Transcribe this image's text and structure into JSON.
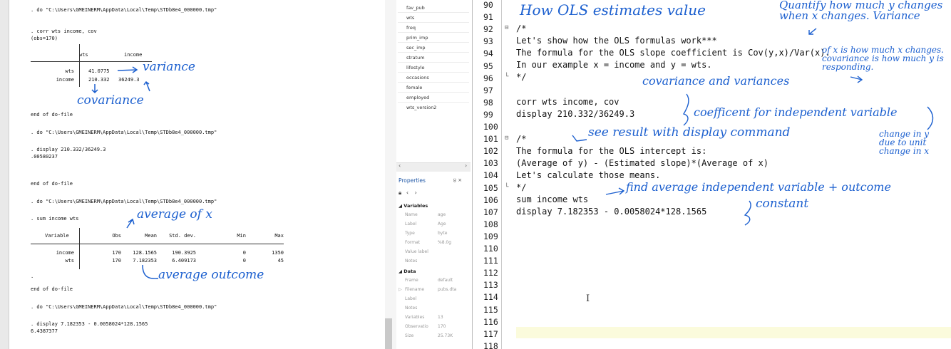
{
  "results": {
    "lines": [
      ". do \"C:\\Users\\GMEINERM\\AppData\\Local\\Temp\\STDb8e4_000000.tmp\"",
      ". corr wts income, cov",
      "(obs=170)",
      "end of do-file",
      ". do \"C:\\Users\\GMEINERM\\AppData\\Local\\Temp\\STDb8e4_000000.tmp\"",
      ". display 210.332/36249.3",
      ".00580237",
      "end of do-file",
      ". do \"C:\\Users\\GMEINERM\\AppData\\Local\\Temp\\STDb8e4_000000.tmp\"",
      ". sum income wts",
      ".",
      "end of do-file",
      ". do \"C:\\Users\\GMEINERM\\AppData\\Local\\Temp\\STDb8e4_000000.tmp\"",
      ". display 7.182353 - 0.0058024*128.1565",
      "6.4387377"
    ],
    "cov_table": {
      "headers": [
        "wts",
        "income"
      ],
      "rows": [
        {
          "label": "wts",
          "values": [
            "41.0775",
            ""
          ]
        },
        {
          "label": "income",
          "values": [
            "210.332",
            "36249.3"
          ]
        }
      ]
    },
    "sum_table": {
      "headers": [
        "Variable",
        "Obs",
        "Mean",
        "Std. dev.",
        "Min",
        "Max"
      ],
      "rows": [
        [
          "income",
          "170",
          "128.1565",
          "190.3925",
          "0",
          "1350"
        ],
        [
          "wts",
          "170",
          "7.182353",
          "6.409173",
          "0",
          "45"
        ]
      ]
    },
    "annotations": [
      "variance",
      "covariance",
      "average of x",
      "average outcome"
    ]
  },
  "variables": {
    "items": [
      "fav_pub",
      "wts",
      "freq",
      "prim_imp",
      "sec_imp",
      "stratum",
      "lifestyle",
      "occasions",
      "female",
      "employed",
      "wts_version2"
    ]
  },
  "properties": {
    "title": "Properties",
    "pin": "੪ ×",
    "sections": {
      "variables": "Variables",
      "data": "Data"
    },
    "variable_props": [
      {
        "name": "Name",
        "value": "age"
      },
      {
        "name": "Label",
        "value": "Age"
      },
      {
        "name": "Type",
        "value": "byte"
      },
      {
        "name": "Format",
        "value": "%8.0g"
      },
      {
        "name": "Value label",
        "value": ""
      },
      {
        "name": "Notes",
        "value": ""
      }
    ],
    "data_props": [
      {
        "name": "Frame",
        "value": "default"
      },
      {
        "name": "Filename",
        "value": "pubs.dta"
      },
      {
        "name": "Label",
        "value": ""
      },
      {
        "name": "Notes",
        "value": ""
      },
      {
        "name": "Variables",
        "value": "13"
      },
      {
        "name": "Observatio",
        "value": "170"
      },
      {
        "name": "Size",
        "value": "25.73K"
      }
    ]
  },
  "editor": {
    "line_numbers": [
      "90",
      "91",
      "92",
      "93",
      "94",
      "95",
      "96",
      "97",
      "98",
      "99",
      "100",
      "101",
      "102",
      "103",
      "104",
      "105",
      "106",
      "107",
      "108",
      "109",
      "110",
      "111",
      "112",
      "113",
      "114",
      "115",
      "116",
      "117",
      "118"
    ],
    "code": [
      {
        "n": 92,
        "text": "/*"
      },
      {
        "n": 93,
        "text": "Let's show how the OLS formulas work***"
      },
      {
        "n": 94,
        "text": "The formula for the OLS slope coefficient is Cov(y,x)/Var(x)."
      },
      {
        "n": 95,
        "text": "In our example x = income and y = wts."
      },
      {
        "n": 96,
        "text": "*/"
      },
      {
        "n": 98,
        "text": "corr wts income, cov"
      },
      {
        "n": 99,
        "text": "display 210.332/36249.3"
      },
      {
        "n": 101,
        "text": "/*"
      },
      {
        "n": 102,
        "text": "The formula for the OLS intercept is:"
      },
      {
        "n": 103,
        "text": "(Average of y) - (Estimated slope)*(Average of x)"
      },
      {
        "n": 104,
        "text": "Let's calculate those means."
      },
      {
        "n": 105,
        "text": "*/"
      },
      {
        "n": 106,
        "text": "sum income wts"
      },
      {
        "n": 107,
        "text": "display 7.182353 - 0.0058024*128.1565"
      }
    ],
    "annotations": [
      "How OLS estimates value",
      "Quantify how much y changes when x changes. Variance",
      "of x is how much x changes. covariance is how much y is responding.",
      "covariance and variances",
      "coefficent for independent variable",
      "see result with display command",
      "change in y due to unit change in x",
      "find average independent variable + outcome",
      "constant"
    ]
  }
}
